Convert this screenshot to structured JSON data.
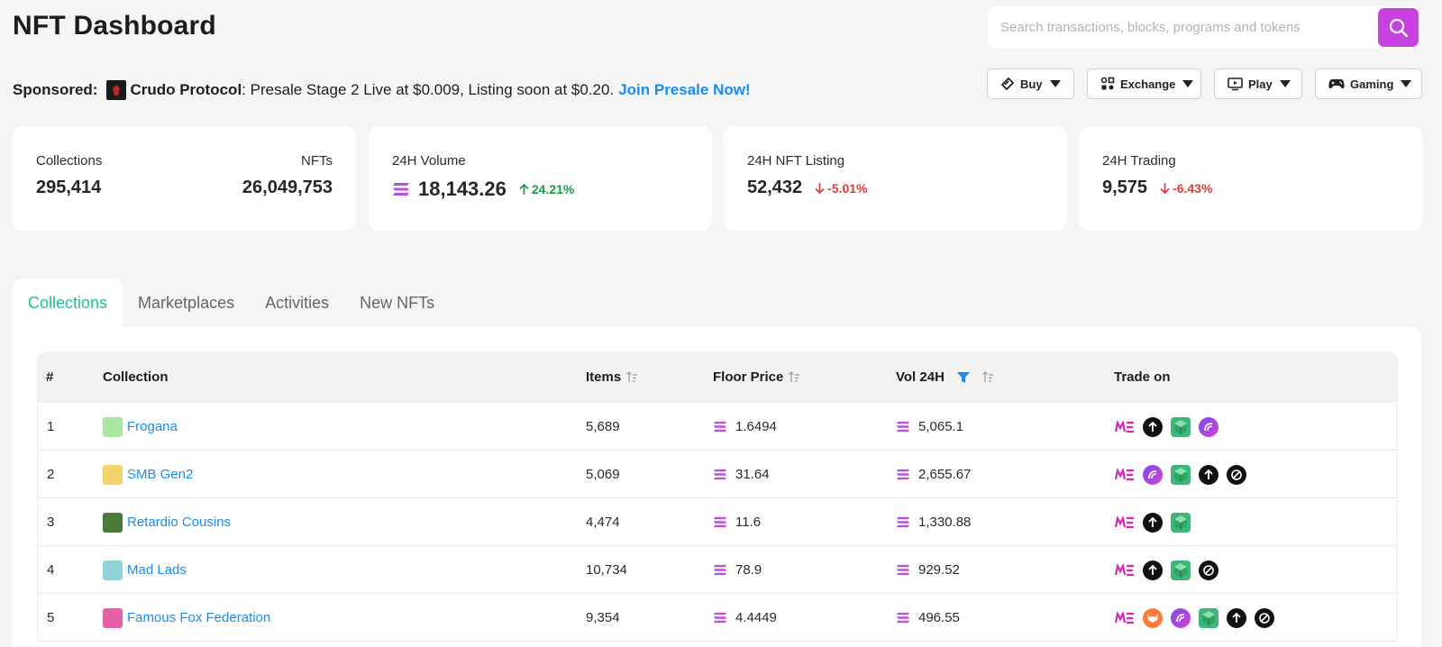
{
  "header": {
    "title": "NFT Dashboard",
    "search_placeholder": "Search transactions, blocks, programs and tokens"
  },
  "sponsored": {
    "label": "Sponsored:",
    "name": "Crudo Protocol",
    "text": ": Presale Stage 2 Live at $0.009, Listing soon at $0.20.",
    "cta": "Join Presale Now!"
  },
  "menus": [
    {
      "label": "Buy",
      "icon": "buy-icon"
    },
    {
      "label": "Exchange",
      "icon": "exchange-icon"
    },
    {
      "label": "Play",
      "icon": "play-icon"
    },
    {
      "label": "Gaming",
      "icon": "gamepad-icon"
    }
  ],
  "stats": {
    "collections_label": "Collections",
    "collections_value": "295,414",
    "nfts_label": "NFTs",
    "nfts_value": "26,049,753",
    "volume_label": "24H Volume",
    "volume_value": "18,143.26",
    "volume_change": "24.21%",
    "listing_label": "24H NFT Listing",
    "listing_value": "52,432",
    "listing_change": "-5.01%",
    "trading_label": "24H Trading",
    "trading_value": "9,575",
    "trading_change": "-6.43%"
  },
  "tabs": [
    "Collections",
    "Marketplaces",
    "Activities",
    "New NFTs"
  ],
  "table": {
    "headers": {
      "rank": "#",
      "collection": "Collection",
      "items": "Items",
      "floor": "Floor Price",
      "vol": "Vol 24H",
      "trade": "Trade on"
    },
    "rows": [
      {
        "rank": "1",
        "name": "Frogana",
        "items": "5,689",
        "floor": "1.6494",
        "vol": "5,065.1",
        "markets": [
          "magic-eden",
          "tensor",
          "sniper",
          "hyperspace"
        ],
        "avatar_color": "#a8e6a1"
      },
      {
        "rank": "2",
        "name": "SMB Gen2",
        "items": "5,069",
        "floor": "31.64",
        "vol": "2,655.67",
        "markets": [
          "magic-eden",
          "hyperspace",
          "sniper",
          "tensor",
          "hadeswap"
        ],
        "avatar_color": "#f3d36b"
      },
      {
        "rank": "3",
        "name": "Retardio Cousins",
        "items": "4,474",
        "floor": "11.6",
        "vol": "1,330.88",
        "markets": [
          "magic-eden",
          "tensor",
          "sniper"
        ],
        "avatar_color": "#4c7a3a"
      },
      {
        "rank": "4",
        "name": "Mad Lads",
        "items": "10,734",
        "floor": "78.9",
        "vol": "929.52",
        "markets": [
          "magic-eden",
          "tensor",
          "sniper",
          "hadeswap"
        ],
        "avatar_color": "#8fd3d8"
      },
      {
        "rank": "5",
        "name": "Famous Fox Federation",
        "items": "9,354",
        "floor": "4.4449",
        "vol": "496.55",
        "markets": [
          "magic-eden",
          "fox",
          "hyperspace",
          "sniper",
          "tensor",
          "hadeswap"
        ],
        "avatar_color": "#e65fa8"
      }
    ]
  },
  "colors": {
    "accent_purple": "#c742e0",
    "link_blue": "#1a8cf0",
    "tab_green": "#1fbf9c",
    "up_green": "#1b9a47",
    "down_red": "#e03a3a"
  }
}
